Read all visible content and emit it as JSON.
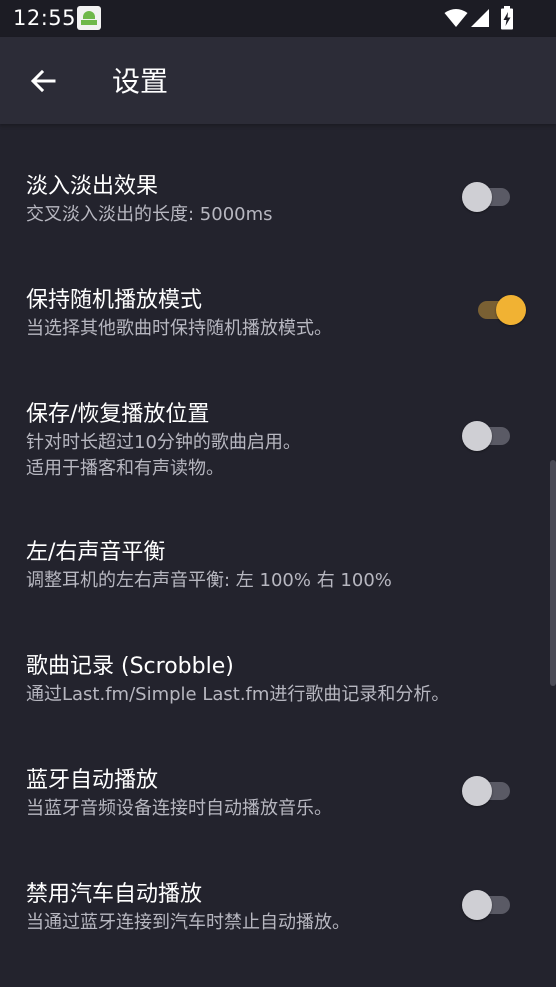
{
  "status_bar": {
    "time": "12:55",
    "icons": [
      "app-notification-icon",
      "wifi-icon",
      "signal-icon",
      "battery-charging-icon"
    ]
  },
  "app_bar": {
    "title": "设置",
    "back_icon": "arrow-left-icon"
  },
  "colors": {
    "background": "#23232d",
    "app_bar": "#2c2c37",
    "accent": "#f1b233",
    "summary_text": "#b7b7c0"
  },
  "preferences": [
    {
      "title": "淡入淡出效果",
      "summary": "交叉淡入淡出的长度: 5000ms",
      "has_switch": true,
      "checked": false
    },
    {
      "title": "保持随机播放模式",
      "summary": "当选择其他歌曲时保持随机播放模式。",
      "has_switch": true,
      "checked": true
    },
    {
      "title": "保存/恢复播放位置",
      "summary": "针对时长超过10分钟的歌曲启用。",
      "summary2": "适用于播客和有声读物。",
      "has_switch": true,
      "checked": false
    },
    {
      "title": "左/右声音平衡",
      "summary": "调整耳机的左右声音平衡: 左 100% 右 100%",
      "has_switch": false
    },
    {
      "title": "歌曲记录 (Scrobble)",
      "summary": "通过Last.fm/Simple Last.fm进行歌曲记录和分析。",
      "has_switch": false
    },
    {
      "title": "蓝牙自动播放",
      "summary": "当蓝牙音频设备连接时自动播放音乐。",
      "has_switch": true,
      "checked": false
    },
    {
      "title": "禁用汽车自动播放",
      "summary": "当通过蓝牙连接到汽车时禁止自动播放。",
      "has_switch": true,
      "checked": false
    }
  ]
}
